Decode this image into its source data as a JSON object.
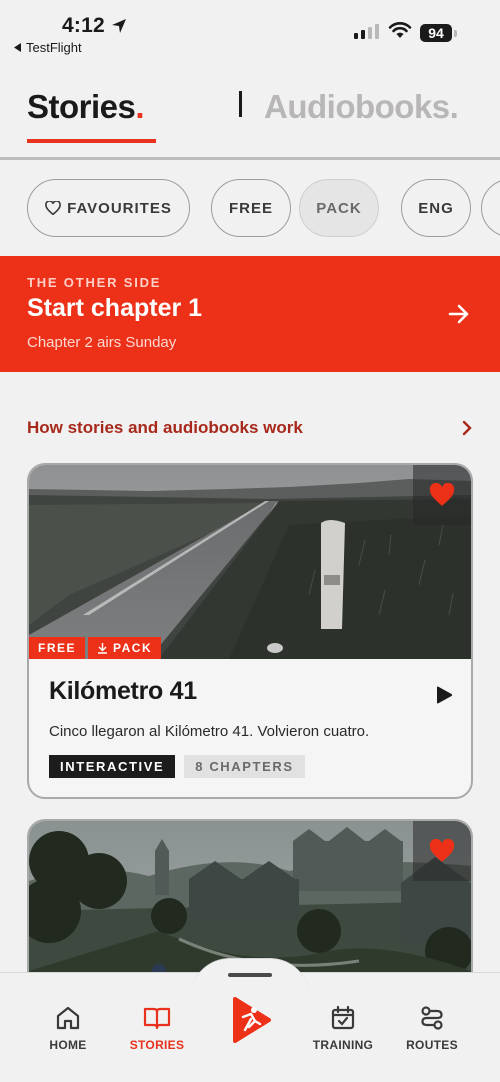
{
  "status_bar": {
    "time": "4:12",
    "back_app": "TestFlight",
    "battery": "94"
  },
  "tabs": {
    "stories": "Stories",
    "stories_dot": ".",
    "audiobooks": "Audiobooks."
  },
  "filters": [
    {
      "label": "FAVOURITES",
      "icon": "heart-outline-icon"
    },
    {
      "label": "FREE"
    },
    {
      "label": "PACK"
    },
    {
      "label": "ENG"
    }
  ],
  "banner": {
    "eyebrow": "THE OTHER SIDE",
    "heading": "Start chapter 1",
    "sub": "Chapter 2 airs Sunday",
    "icon": "arrow-right-icon"
  },
  "how_link": {
    "label": "How stories and audiobooks work",
    "icon": "chevron-right-icon"
  },
  "cards": [
    {
      "badges": [
        "FREE",
        "PACK"
      ],
      "title": "Kilómetro 41",
      "description": "Cinco llegaron al Kilómetro 41. Volvieron cuatro.",
      "tags": [
        "INTERACTIVE",
        "8 CHAPTERS"
      ],
      "favourite_icon": "heart-filled-icon",
      "play_icon": "play-icon"
    },
    {
      "favourite_icon": "heart-filled-icon"
    }
  ],
  "nav": [
    {
      "label": "HOME",
      "icon": "home-icon"
    },
    {
      "label": "STORIES",
      "icon": "book-icon",
      "active": true
    },
    {
      "label": "",
      "icon": "runner-logo-icon"
    },
    {
      "label": "TRAINING",
      "icon": "calendar-check-icon"
    },
    {
      "label": "ROUTES",
      "icon": "route-icon"
    }
  ],
  "colors": {
    "accent": "#ec3118",
    "link": "#a7291b",
    "text": "#1a1a1a",
    "muted": "#b8b6b6",
    "background": "#f2f1f1"
  }
}
